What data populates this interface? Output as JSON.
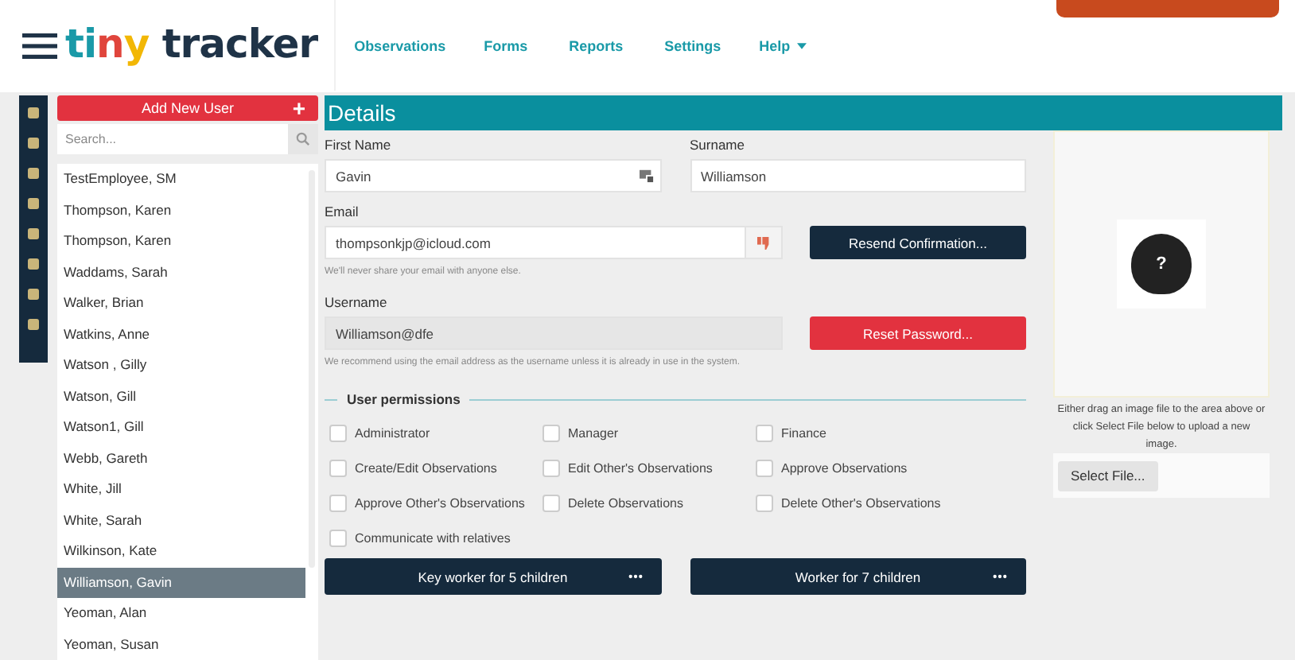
{
  "logo": [
    {
      "text": "t",
      "color": "#1a9aa8"
    },
    {
      "text": "i",
      "color": "#1a9aa8"
    },
    {
      "text": "n",
      "color": "#e0453c"
    },
    {
      "text": "y",
      "color": "#f2b705"
    },
    {
      "text": " tracker",
      "color": "#1f3347"
    }
  ],
  "nav": [
    {
      "label": "Observations",
      "kind": "link"
    },
    {
      "label": "Forms",
      "kind": "link"
    },
    {
      "label": "Reports",
      "kind": "link"
    },
    {
      "label": "Settings",
      "kind": "link"
    },
    {
      "label": "Help",
      "kind": "dropdown"
    }
  ],
  "sidebar": {
    "add_button": "Add New User",
    "add_icon": "+",
    "search": {
      "placeholder": "Search..."
    },
    "users": [
      {
        "name": "TestEmployee, SM",
        "selected": false
      },
      {
        "name": "Thompson, Karen",
        "selected": false
      },
      {
        "name": "Thompson, Karen",
        "selected": false
      },
      {
        "name": "Waddams, Sarah",
        "selected": false
      },
      {
        "name": "Walker, Brian",
        "selected": false
      },
      {
        "name": "Watkins, Anne",
        "selected": false
      },
      {
        "name": "Watson , Gilly",
        "selected": false
      },
      {
        "name": "Watson, Gill",
        "selected": false
      },
      {
        "name": "Watson1, Gill",
        "selected": false
      },
      {
        "name": "Webb, Gareth",
        "selected": false
      },
      {
        "name": "White, Jill",
        "selected": false
      },
      {
        "name": "White, Sarah",
        "selected": false
      },
      {
        "name": "Wilkinson, Kate",
        "selected": false
      },
      {
        "name": "Williamson, Gavin",
        "selected": true
      },
      {
        "name": "Yeoman, Alan",
        "selected": false
      },
      {
        "name": "Yeoman, Susan",
        "selected": false
      }
    ]
  },
  "details": {
    "title": "Details",
    "first_name": {
      "label": "First Name",
      "value": "Gavin"
    },
    "surname": {
      "label": "Surname",
      "value": "Williamson"
    },
    "email": {
      "label": "Email",
      "value": "thompsonkjp@icloud.com",
      "hint": "We'll never share your email with anyone else.",
      "button": "Resend Confirmation..."
    },
    "username": {
      "label": "Username",
      "value": "Williamson@dfe",
      "disabled": true,
      "hint": "We recommend using the email address as the username unless it is already in use in the system.",
      "button": "Reset Password..."
    },
    "permissions": {
      "legend": "User permissions",
      "items": [
        {
          "label": "Administrator",
          "checked": false
        },
        {
          "label": "Manager",
          "checked": false
        },
        {
          "label": "Finance",
          "checked": false
        },
        {
          "label": "Create/Edit Observations",
          "checked": false
        },
        {
          "label": "Edit Other's Observations",
          "checked": false
        },
        {
          "label": "Approve Observations",
          "checked": false
        },
        {
          "label": "Approve Other's Observations",
          "checked": false
        },
        {
          "label": "Delete Observations",
          "checked": false
        },
        {
          "label": "Delete Other's Observations",
          "checked": false
        },
        {
          "label": "Communicate with relatives",
          "checked": false
        }
      ]
    },
    "worker_buttons": [
      {
        "label": "Key worker for 5 children"
      },
      {
        "label": "Worker for 7 children"
      }
    ]
  },
  "photo": {
    "avatar_mark": "?",
    "hint": "Either drag an image file to the area above or click Select File below to upload a new image.",
    "select_button": "Select File..."
  }
}
